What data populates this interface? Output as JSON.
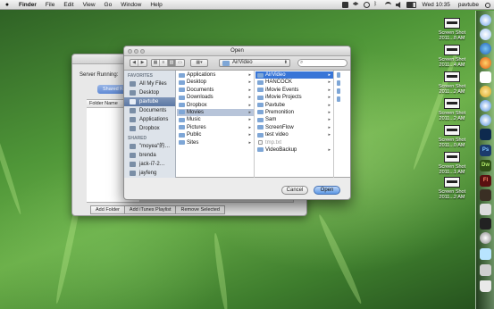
{
  "menubar": {
    "apple": "",
    "items": [
      "Finder",
      "File",
      "Edit",
      "View",
      "Go",
      "Window",
      "Help"
    ],
    "clock": "Wed 10:35",
    "user": "pavtube"
  },
  "background_window": {
    "server_label": "Server Running:",
    "tab": "Shared F...",
    "column_header": "Folder Name",
    "buttons": [
      "Add Folder",
      "Add iTunes Playlist",
      "Remove Selected"
    ]
  },
  "dialog": {
    "title": "Open",
    "location": "AirVideo",
    "search_placeholder": "",
    "sidebar": {
      "favorites_header": "FAVORITES",
      "favorites": [
        "All My Files",
        "Desktop",
        "pavtube",
        "Documents",
        "Applications",
        "Dropbox"
      ],
      "selected_favorite": "pavtube",
      "shared_header": "SHARED",
      "shared": [
        "\"moyea\"的…",
        "brenda",
        "jack-i7-2…",
        "jayfeng"
      ]
    },
    "column1": [
      "Applications",
      "Desktop",
      "Documents",
      "Downloads",
      "Dropbox",
      "Movies",
      "Music",
      "Pictures",
      "Public",
      "Sites"
    ],
    "column1_selected": "Movies",
    "column2": [
      "AirVideo",
      "HANCOCK",
      "iMovie Events",
      "iMovie Projects",
      "Pavtube",
      "Premonition",
      "Sam",
      "ScreenFlow",
      "test video",
      "tmp.txt",
      "VideoBackup"
    ],
    "column2_selected": "AirVideo",
    "column2_dim": [
      "tmp.txt"
    ],
    "column2_files": [
      "tmp.txt"
    ],
    "cancel_label": "Cancel",
    "open_label": "Open"
  },
  "desktop_icons": [
    {
      "label1": "Screen Shot",
      "label2": "2011...8 AM"
    },
    {
      "label1": "Screen Shot",
      "label2": "2011...4 AM"
    },
    {
      "label1": "Screen Shot",
      "label2": "2011...2 AM"
    },
    {
      "label1": "Screen Shot",
      "label2": "2011...2 AM"
    },
    {
      "label1": "Screen Shot",
      "label2": "2011...0 AM"
    },
    {
      "label1": "Screen Shot",
      "label2": "2011...1 AM"
    },
    {
      "label1": "Screen Shot",
      "label2": "2011...2 AM"
    }
  ],
  "dock": {
    "labels": [
      "Ps",
      "Dw",
      "Fl"
    ]
  },
  "colors": {
    "selection_blue": "#3875d7",
    "sidebar_bg": "#dde3ea",
    "wallpaper_green": "#4f9638"
  }
}
